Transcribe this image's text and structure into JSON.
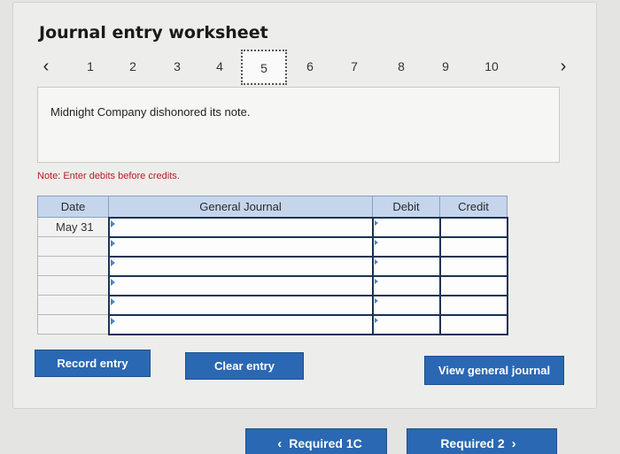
{
  "title": "Journal entry worksheet",
  "pager": {
    "prev_icon": "‹",
    "next_icon": "›",
    "pages": [
      "1",
      "2",
      "3",
      "4",
      "5",
      "6",
      "7",
      "8",
      "9",
      "10"
    ],
    "active": "5"
  },
  "scenario": "Midnight Company dishonored its note.",
  "note": "Note: Enter debits before credits.",
  "table": {
    "headers": [
      "Date",
      "General Journal",
      "Debit",
      "Credit"
    ],
    "rows": [
      {
        "date": "May 31",
        "account": "",
        "debit": "",
        "credit": ""
      },
      {
        "date": "",
        "account": "",
        "debit": "",
        "credit": ""
      },
      {
        "date": "",
        "account": "",
        "debit": "",
        "credit": ""
      },
      {
        "date": "",
        "account": "",
        "debit": "",
        "credit": ""
      },
      {
        "date": "",
        "account": "",
        "debit": "",
        "credit": ""
      },
      {
        "date": "",
        "account": "",
        "debit": "",
        "credit": ""
      }
    ]
  },
  "buttons": {
    "record": "Record entry",
    "clear": "Clear entry",
    "view": "View general journal"
  },
  "nav": {
    "prev_label": "Required 1C",
    "next_label": "Required 2",
    "prev_icon": "‹",
    "next_icon": "›"
  },
  "colors": {
    "button_blue": "#2a68b3",
    "header_blue": "#c5d6ec",
    "note_red": "#b02020"
  }
}
